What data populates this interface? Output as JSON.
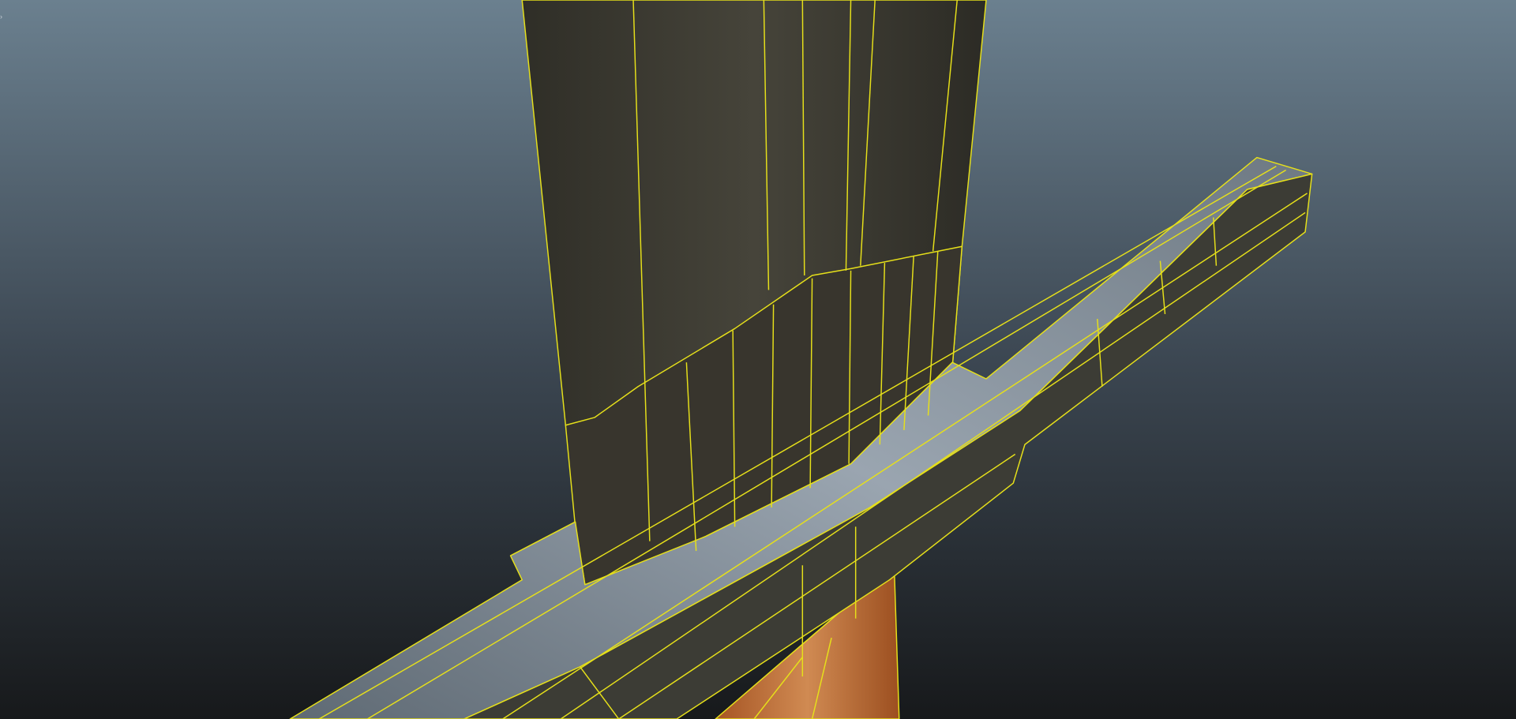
{
  "viewport": {
    "background_top": "#6b808f",
    "background_bottom": "#17191b",
    "wireframe_color": "#e6e01a",
    "blade_color": "#3b3a31",
    "steel_color": "#7f8a95",
    "steel_dark": "#3a3a34",
    "grip_color": "#b8652c"
  }
}
